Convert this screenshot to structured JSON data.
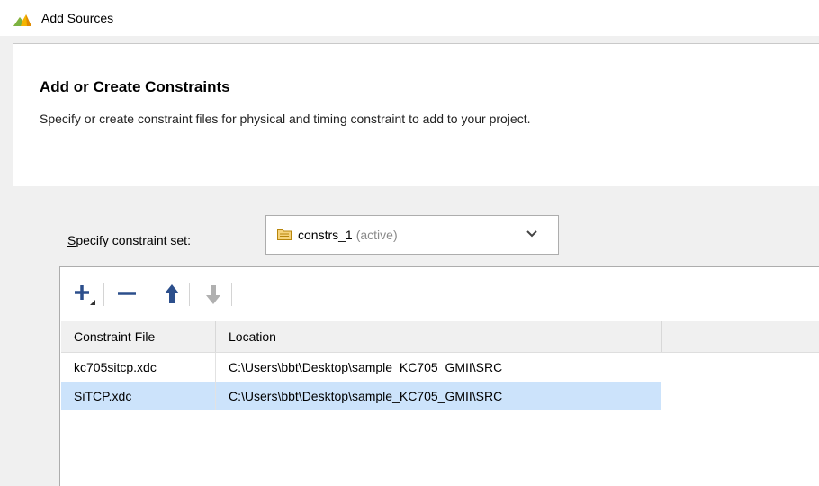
{
  "window": {
    "title": "Add Sources",
    "icon": "vivado-logo-icon"
  },
  "header": {
    "title": "Add or Create Constraints",
    "description": "Specify or create constraint files for physical and timing constraint to add to your project."
  },
  "constraint_set": {
    "label_accel": "S",
    "label_rest": "pecify constraint set:",
    "value": "constrs_1",
    "status": "(active)"
  },
  "toolbar": {
    "buttons": [
      {
        "name": "add",
        "icon": "plus-icon",
        "enabled": true
      },
      {
        "name": "remove",
        "icon": "minus-icon",
        "enabled": true
      },
      {
        "name": "move-up",
        "icon": "arrow-up-icon",
        "enabled": true
      },
      {
        "name": "move-down",
        "icon": "arrow-down-icon",
        "enabled": false
      }
    ]
  },
  "table": {
    "columns": [
      "Constraint File",
      "Location"
    ],
    "rows": [
      {
        "file": "kc705sitcp.xdc",
        "location": "C:\\Users\\bbt\\Desktop\\sample_KC705_GMII\\SRC",
        "selected": false
      },
      {
        "file": "SiTCP.xdc",
        "location": "C:\\Users\\bbt\\Desktop\\sample_KC705_GMII\\SRC",
        "selected": true
      }
    ]
  },
  "colors": {
    "selection": "#cce3fb",
    "accent": "#2c4f8c",
    "disabled": "#b0b0b0"
  }
}
